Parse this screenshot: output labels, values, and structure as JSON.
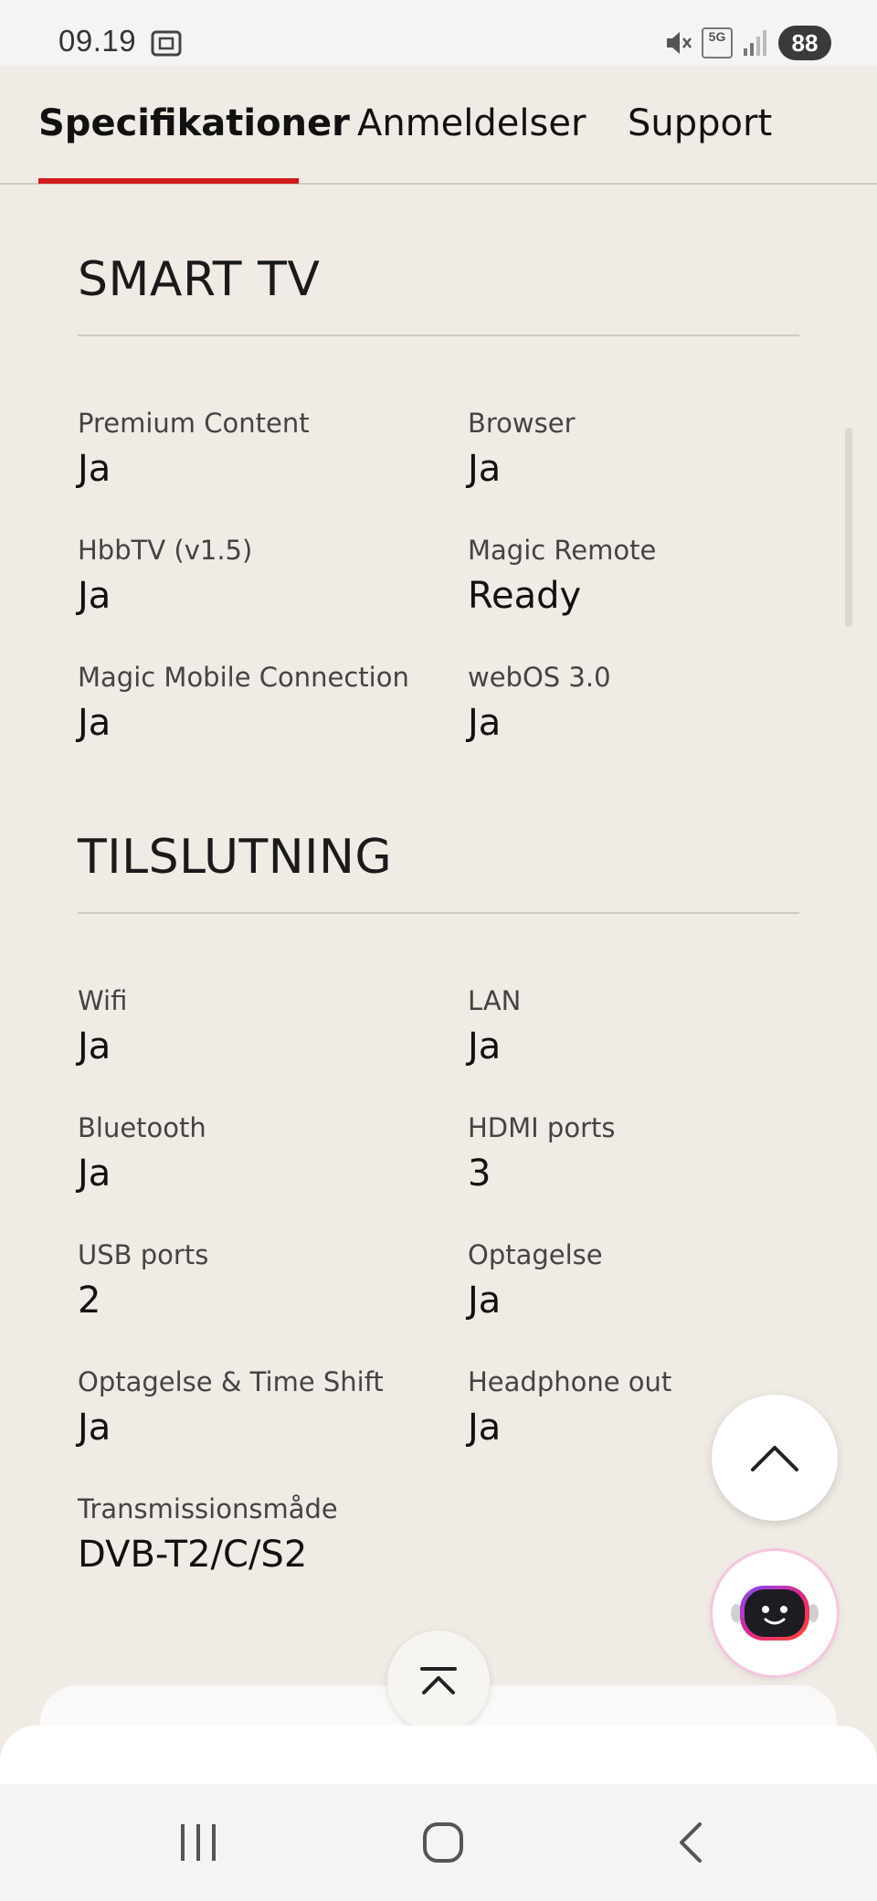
{
  "status_bar": {
    "time": "09.19",
    "battery": "88",
    "network": "5G"
  },
  "tabs": [
    {
      "label": "Specifikationer",
      "active": true
    },
    {
      "label": "Anmeldelser",
      "active": false
    },
    {
      "label": "Support",
      "active": false
    }
  ],
  "accent_color": "#d11a1a",
  "sections": [
    {
      "title": "SMART TV",
      "specs": [
        {
          "label": "Premium Content",
          "value": "Ja"
        },
        {
          "label": "Browser",
          "value": "Ja"
        },
        {
          "label": "HbbTV (v1.5)",
          "value": "Ja"
        },
        {
          "label": "Magic Remote",
          "value": "Ready"
        },
        {
          "label": "Magic Mobile Connection",
          "value": "Ja"
        },
        {
          "label": "webOS 3.0",
          "value": "Ja"
        }
      ]
    },
    {
      "title": "TILSLUTNING",
      "specs": [
        {
          "label": "Wifi",
          "value": "Ja"
        },
        {
          "label": "LAN",
          "value": "Ja"
        },
        {
          "label": "Bluetooth",
          "value": "Ja"
        },
        {
          "label": "HDMI ports",
          "value": "3"
        },
        {
          "label": "USB ports",
          "value": "2"
        },
        {
          "label": "Optagelse",
          "value": "Ja"
        },
        {
          "label": "Optagelse & Time Shift",
          "value": "Ja"
        },
        {
          "label": "Headphone out",
          "value": "Ja"
        },
        {
          "label": "Transmissionsmåde",
          "value": "DVB-T2/C/S2"
        }
      ]
    }
  ],
  "icons": {
    "scroll_up": "chevron-up-icon",
    "chatbot": "chatbot-robot-icon",
    "back_to_top": "back-to-top-icon",
    "nav_recents": "recents-icon",
    "nav_home": "home-icon",
    "nav_back": "back-icon"
  }
}
